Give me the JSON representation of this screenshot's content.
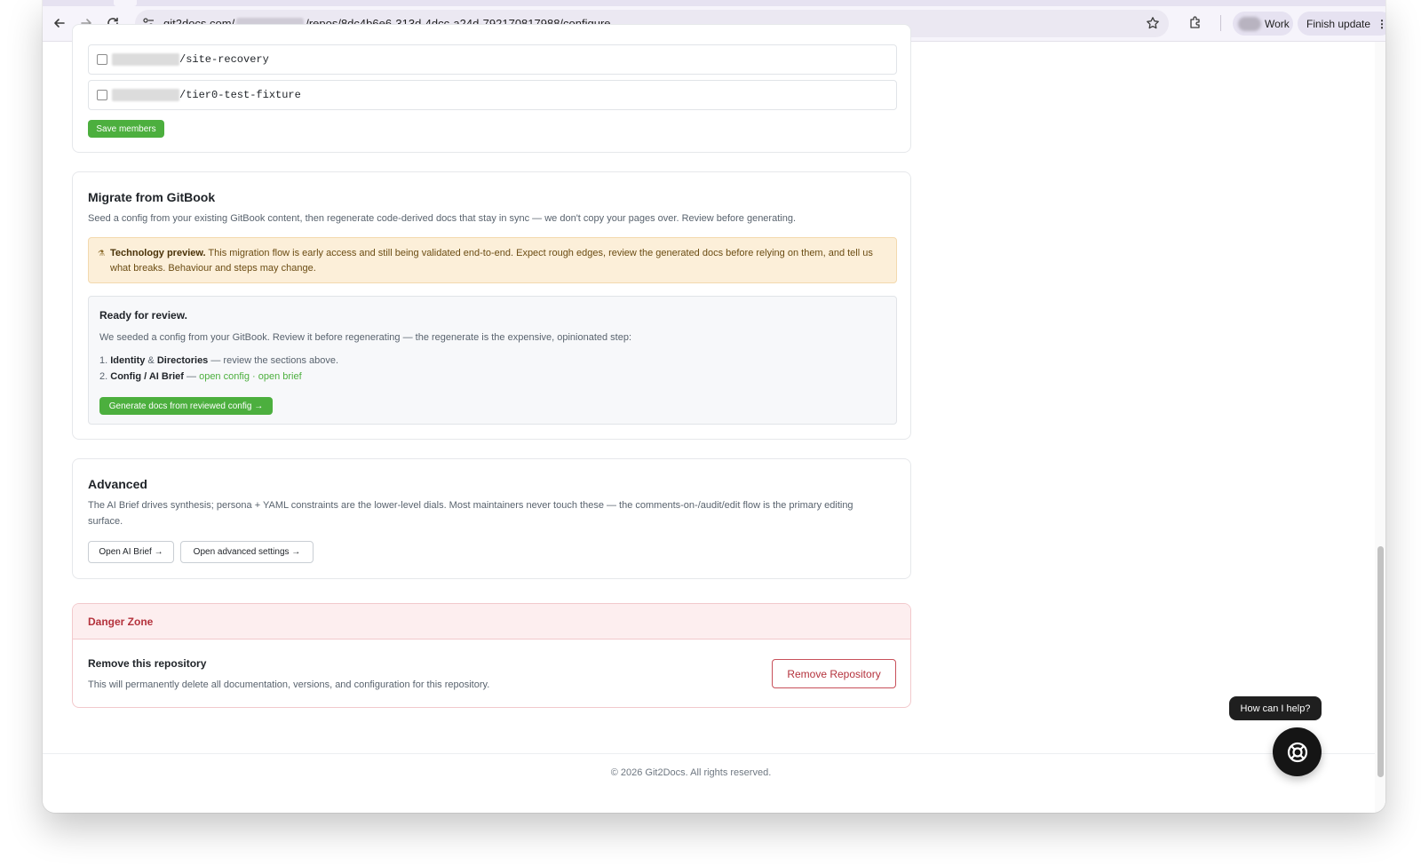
{
  "browser": {
    "url_prefix": "git2docs.com/",
    "url_suffix": "/repos/8dc4b6e6-313d-4dcc-a24d-792170817988/configure",
    "profile_label": "Work",
    "finish_update_label": "Finish update",
    "icons": [
      "back-icon",
      "forward-icon",
      "reload-icon",
      "site-settings-icon",
      "bookmark-star-icon",
      "extensions-icon",
      "more-icon"
    ]
  },
  "members": {
    "rows": [
      {
        "name": "/site-recovery"
      },
      {
        "name": "/tier0-test-fixture"
      }
    ],
    "save_label": "Save members"
  },
  "migrate": {
    "title": "Migrate from GitBook",
    "description": "Seed a config from your existing GitBook content, then regenerate code-derived docs that stay in sync — we don't copy your pages over. Review before generating.",
    "warning_icon": "⚗",
    "warning_bold": "Technology preview.",
    "warning_text": " This migration flow is early access and still being validated end-to-end. Expect rough edges, review the generated docs before relying on them, and tell us what breaks. Behaviour and steps may change.",
    "review": {
      "title": "Ready for review.",
      "intro": "We seeded a config from your GitBook. Review it before regenerating — the regenerate is the expensive, opinionated step:",
      "step1_num": "1.",
      "step1_a": "Identity",
      "step1_amp": " & ",
      "step1_b": "Directories",
      "step1_rest": " — review the sections above.",
      "step2_num": "2.",
      "step2_bold": "Config / AI Brief",
      "step2_dash": " — ",
      "step2_link1": "open config",
      "step2_dot": " · ",
      "step2_link2": "open brief",
      "generate_label": "Generate docs from reviewed config →"
    }
  },
  "advanced": {
    "title": "Advanced",
    "description": "The AI Brief drives synthesis; persona + YAML constraints are the lower-level dials. Most maintainers never touch these — the comments-on-/audit/edit flow is the primary editing surface.",
    "open_brief_label": "Open AI Brief →",
    "open_settings_label": "Open advanced settings →"
  },
  "danger": {
    "title": "Danger Zone",
    "remove_title": "Remove this repository",
    "remove_desc": "This will permanently delete all documentation, versions, and configuration for this repository.",
    "remove_button": "Remove Repository"
  },
  "footer": {
    "text": "© 2026 Git2Docs. All rights reserved."
  },
  "help": {
    "bubble": "How can I help?"
  }
}
